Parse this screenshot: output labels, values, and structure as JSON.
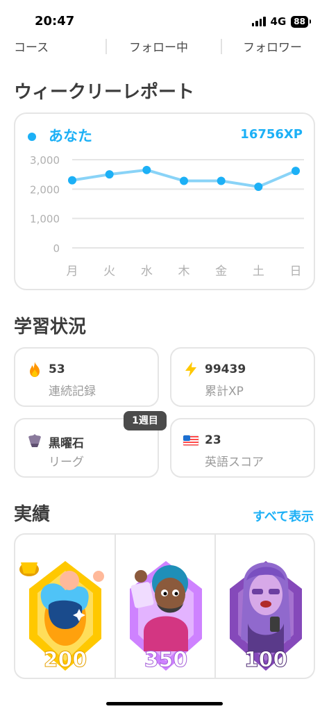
{
  "status_bar": {
    "time": "20:47",
    "network": "4G",
    "battery": "88"
  },
  "profile_tabs": [
    "コース",
    "フォロー中",
    "フォロワー"
  ],
  "weekly_report": {
    "title": "ウィークリーレポート",
    "legend": {
      "name": "あなた",
      "xp": "16756XP",
      "color": "#1cb0f6"
    }
  },
  "chart_data": {
    "type": "line",
    "categories": [
      "月",
      "火",
      "水",
      "木",
      "金",
      "土",
      "日"
    ],
    "series": [
      {
        "name": "あなた",
        "values": [
          2300,
          2500,
          2650,
          2280,
          2280,
          2080,
          2620
        ]
      }
    ],
    "yticks": [
      "3,000",
      "2,000",
      "1,000",
      "0"
    ],
    "ylim": [
      0,
      3000
    ],
    "grid": true,
    "line_color": "#89d3f7",
    "point_color": "#1cb0f6"
  },
  "learning_status": {
    "title": "学習状況",
    "stats": [
      {
        "value": "53",
        "label": "連続記録",
        "icon": "flame-icon"
      },
      {
        "value": "99439",
        "label": "累計XP",
        "icon": "lightning-icon"
      },
      {
        "value": "黒曜石",
        "label": "リーグ",
        "icon": "obsidian-league-icon"
      },
      {
        "value": "23",
        "label": "英語スコア",
        "icon": "us-flag-icon"
      }
    ],
    "badge": "1週目"
  },
  "achievements": {
    "title": "実績",
    "see_all": "すべて表示",
    "items": [
      {
        "count": "200",
        "icon": "trophy-badge-icon",
        "color": "#ffc800"
      },
      {
        "count": "350",
        "icon": "character-badge-icon",
        "color": "#ce82ff"
      },
      {
        "count": "100",
        "icon": "lily-badge-icon",
        "color": "#8549ba"
      }
    ]
  }
}
